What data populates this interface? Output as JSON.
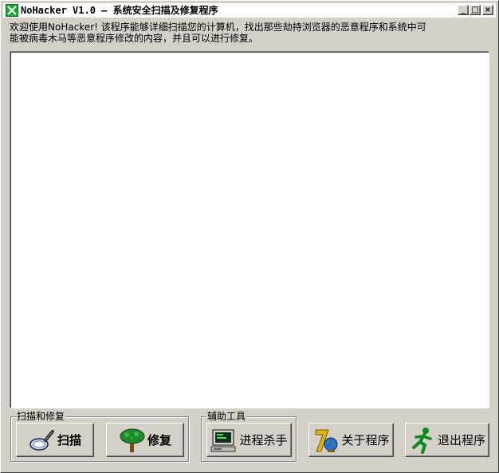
{
  "window": {
    "title": "NoHacker V1.0 — 系统安全扫描及修复程序",
    "minimize_glyph": "_",
    "maximize_glyph": "□",
    "close_glyph": "×"
  },
  "intro": {
    "line1": "欢迎使用NoHacker! 该程序能够详细扫描您的计算机，找出那些劫持浏览器的恶意程序和系统中可",
    "line2": "能被病毒木马等恶意程序修改的内容，并且可以进行修复。"
  },
  "groups": {
    "scan_repair": {
      "label": "扫描和修复"
    },
    "tools": {
      "label": "辅助工具"
    }
  },
  "buttons": {
    "scan": {
      "label": "扫描",
      "icon": "magnifier-icon"
    },
    "repair": {
      "label": "修复",
      "icon": "tree-icon"
    },
    "kill": {
      "label": "进程杀手",
      "icon": "computer-icon"
    },
    "about": {
      "label": "关于程序",
      "icon": "seven-globe-icon"
    },
    "exit": {
      "label": "退出程序",
      "icon": "running-man-icon"
    }
  },
  "colors": {
    "face": "#d4d0c8",
    "content_bg": "#ffffff",
    "icon_green": "#0a8a1e"
  }
}
